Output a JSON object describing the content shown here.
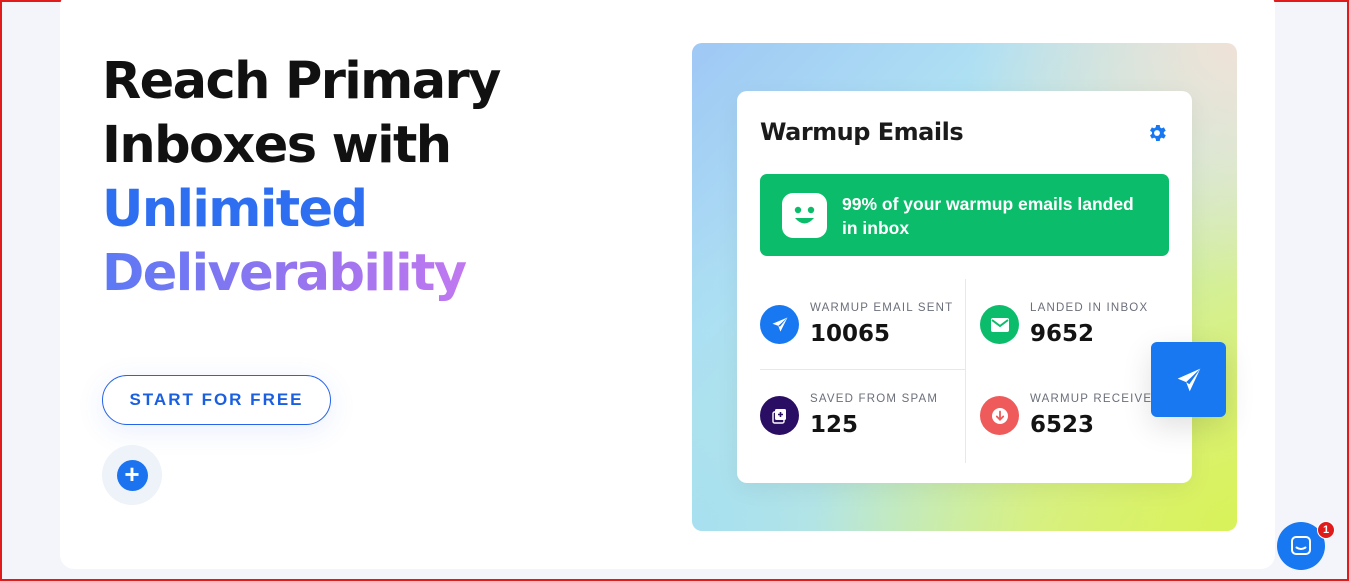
{
  "hero": {
    "line1": "Reach Primary",
    "line2": "Inboxes with",
    "line3": "Unlimited",
    "line4": "Deliverability",
    "cta_label": "START FOR FREE"
  },
  "widget": {
    "title": "Warmup Emails",
    "banner_text": "99% of your warmup emails landed in inbox",
    "stats": [
      {
        "label": "WARMUP EMAIL SENT",
        "value": "10065",
        "icon": "send-icon",
        "color": "#1778f2"
      },
      {
        "label": "LANDED IN INBOX",
        "value": "9652",
        "icon": "mail-icon",
        "color": "#0bbd6b"
      },
      {
        "label": "SAVED FROM SPAM",
        "value": "125",
        "icon": "spam-icon",
        "color": "#2a0e63"
      },
      {
        "label": "WARMUP RECEIVED",
        "value": "6523",
        "icon": "download-icon",
        "color": "#ef5a5a"
      }
    ]
  },
  "chat": {
    "badge": "1"
  },
  "colors": {
    "accent": "#1778f2",
    "success": "#0bbd6b",
    "danger": "#ef5a5a"
  }
}
